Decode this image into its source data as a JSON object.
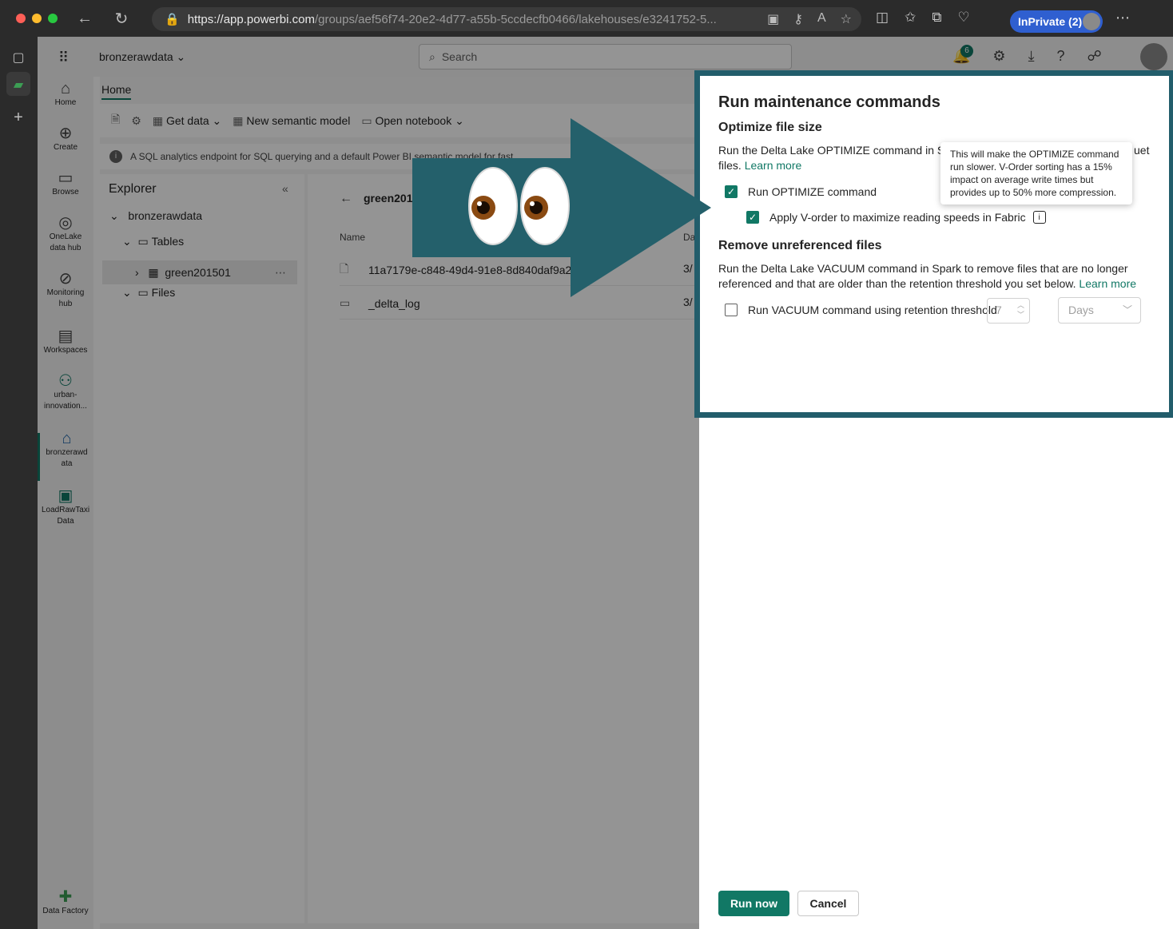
{
  "browser": {
    "url_host": "https://app.powerbi.com",
    "url_path": "/groups/aef56f74-20e2-4d77-a55b-5ccdecfb0466/lakehouses/e3241752-5...",
    "inprivate_label": "InPrivate (2)"
  },
  "header": {
    "workspace_name": "bronzerawdata",
    "search_placeholder": "Search",
    "notification_count": "6"
  },
  "leftnav": {
    "items": [
      {
        "label": "Home"
      },
      {
        "label": "Create"
      },
      {
        "label": "Browse"
      },
      {
        "label": "OneLake data hub"
      },
      {
        "label": "Monitoring hub"
      },
      {
        "label": "Workspaces"
      },
      {
        "label": "urban-innovation..."
      },
      {
        "label": "bronzerawd ata"
      },
      {
        "label": "LoadRawTaxi Data"
      },
      {
        "label": "Data Factory"
      }
    ]
  },
  "ribbon": {
    "tab": "Home",
    "get_data": "Get data",
    "new_semantic_model": "New semantic model",
    "open_notebook": "Open notebook"
  },
  "infobar": {
    "text": "A SQL analytics endpoint for SQL querying and a default Power BI semantic model for fast..."
  },
  "explorer": {
    "title": "Explorer",
    "root": "bronzerawdata",
    "tables": "Tables",
    "table_item": "green201501",
    "files": "Files"
  },
  "content": {
    "breadcrumb": "green2015",
    "col_name": "Name",
    "col_date": "Da",
    "rows": [
      {
        "name": "11a7179e-c848-49d4-91e8-8d840daf9a2",
        "date": "3/"
      },
      {
        "name": "_delta_log",
        "date": "3/"
      }
    ]
  },
  "panel": {
    "title": "Run maintenance commands",
    "optimize_heading": "Optimize file size",
    "optimize_desc": "Run the Delta Lake OPTIMIZE command in Sp",
    "optimize_desc_end": "uet",
    "optimize_desc2": "files.",
    "learn_more": "Learn more",
    "run_optimize_label": "Run OPTIMIZE command",
    "vorder_label": "Apply V-order to maximize reading speeds in Fabric",
    "tooltip": "This will make the OPTIMIZE command run slower. V-Order sorting has a 15% impact on average write times but provides up to 50% more compression.",
    "vacuum_heading": "Remove unreferenced files",
    "vacuum_desc": "Run the Delta Lake VACUUM command in Spark to remove files that are no longer referenced and that are older than the retention threshold you set below.",
    "vacuum_label": "Run VACUUM command using retention threshold",
    "retention_value": "7",
    "retention_unit": "Days",
    "run_now": "Run now",
    "cancel": "Cancel"
  },
  "colors": {
    "accent": "#117865",
    "highlight_border": "#225d6b",
    "arrow": "#24606b"
  }
}
